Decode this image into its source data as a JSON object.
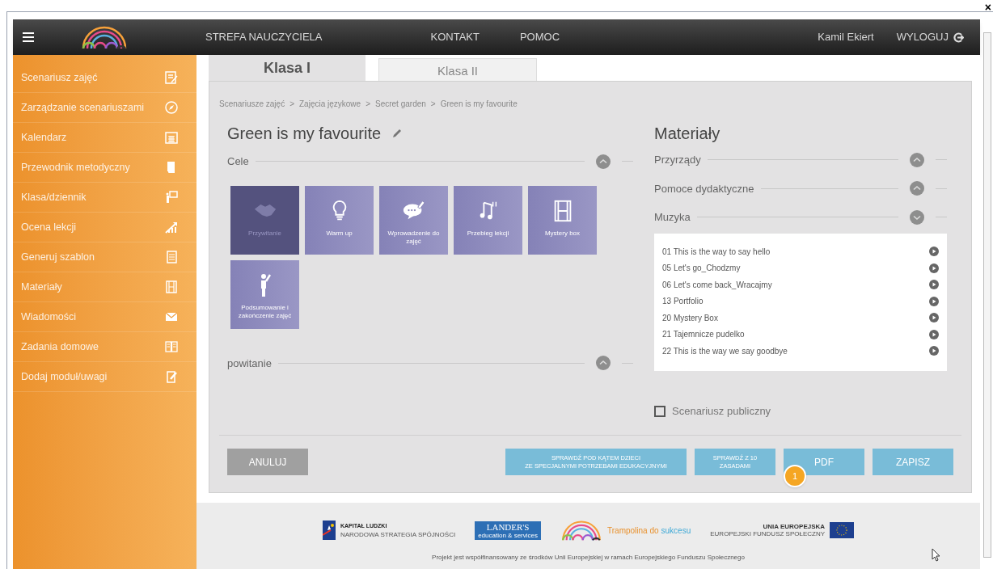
{
  "header": {
    "title": "STREFA NAUCZYCIELA",
    "nav": [
      "KONTAKT",
      "POMOC"
    ],
    "user": "Kamil Ekiert",
    "logout": "WYLOGUJ",
    "close": "×"
  },
  "sidebar": {
    "items": [
      {
        "label": "Scenariusz zajęć"
      },
      {
        "label": "Zarządzanie scenariuszami"
      },
      {
        "label": "Kalendarz"
      },
      {
        "label": "Przewodnik metodyczny"
      },
      {
        "label": "Klasa/dziennik"
      },
      {
        "label": "Ocena lekcji"
      },
      {
        "label": "Generuj szablon"
      },
      {
        "label": "Materiały"
      },
      {
        "label": "Wiadomości"
      },
      {
        "label": "Zadania domowe"
      },
      {
        "label": "Dodaj moduł/uwagi"
      }
    ]
  },
  "tabs": [
    {
      "label": "Klasa I",
      "selected": true
    },
    {
      "label": "Klasa II",
      "selected": false
    }
  ],
  "breadcrumb": [
    "Scenariusze zajęć",
    "Zajęcia językowe",
    "Secret garden",
    "Green is my favourite"
  ],
  "breadcrumb_separator": ">",
  "title": "Green is my favourite",
  "sections_left": [
    {
      "label": "Cele",
      "expanded": false
    },
    {
      "label": "powitanie",
      "expanded": false
    }
  ],
  "tiles": [
    {
      "label": "Przywitanie",
      "selected": true
    },
    {
      "label": "Warm up",
      "selected": false
    },
    {
      "label": "Wprowadzenie do zajęć",
      "selected": false
    },
    {
      "label": "Przebieg lekcji",
      "selected": false
    },
    {
      "label": "Mystery box",
      "selected": false
    },
    {
      "label": "Podsumowanie i zakończenie zajęć",
      "selected": false
    }
  ],
  "materials": {
    "title": "Materiały",
    "sections": [
      {
        "label": "Przyrządy",
        "expanded": false
      },
      {
        "label": "Pomoce dydaktyczne",
        "expanded": false
      },
      {
        "label": "Muzyka",
        "expanded": true
      }
    ],
    "tracks": [
      "01 This is the way to say hello",
      "05 Let's go_Chodzmy",
      "06 Let's come back_Wracajmy",
      "13 Portfolio",
      "20 Mystery Box",
      "21 Tajemnicze pudelko",
      "22 This is the way we say goodbye"
    ]
  },
  "public_checkbox": {
    "label": "Scenariusz publiczny",
    "checked": false
  },
  "buttons": [
    {
      "kind": "cancel",
      "lines": [
        "ANULUJ"
      ]
    },
    {
      "kind": "action",
      "lines": [
        "SPRAWDŹ POD KĄTEM DZIECI",
        "ZE SPECJALNYMI POTRZEBAMI EDUKACYJNYMI"
      ]
    },
    {
      "kind": "action",
      "lines": [
        "SPRAWDŹ Z 10",
        "ZASADAMI"
      ]
    },
    {
      "kind": "action",
      "lines": [
        "PDF"
      ],
      "badge": "1"
    },
    {
      "kind": "action",
      "lines": [
        "ZAPISZ"
      ]
    }
  ],
  "footer": {
    "logos": [
      {
        "kind": "kl",
        "title": "KAPITAŁ LUDZKI",
        "subtitle": "NARODOWA STRATEGIA SPÓJNOŚCI"
      },
      {
        "kind": "landers",
        "title": "LANDER'S",
        "subtitle": "education & services"
      },
      {
        "kind": "trampolina",
        "title": "Trampolina do",
        "subtitle": "sukcesu"
      },
      {
        "kind": "ue",
        "title": "UNIA EUROPEJSKA",
        "subtitle": "EUROPEJSKI FUNDUSZ SPOŁECZNY"
      }
    ],
    "note": "Projekt jest współfinansowany ze środków Unii Europejskiej w ramach Europejskiego Funduszu Społecznego"
  }
}
